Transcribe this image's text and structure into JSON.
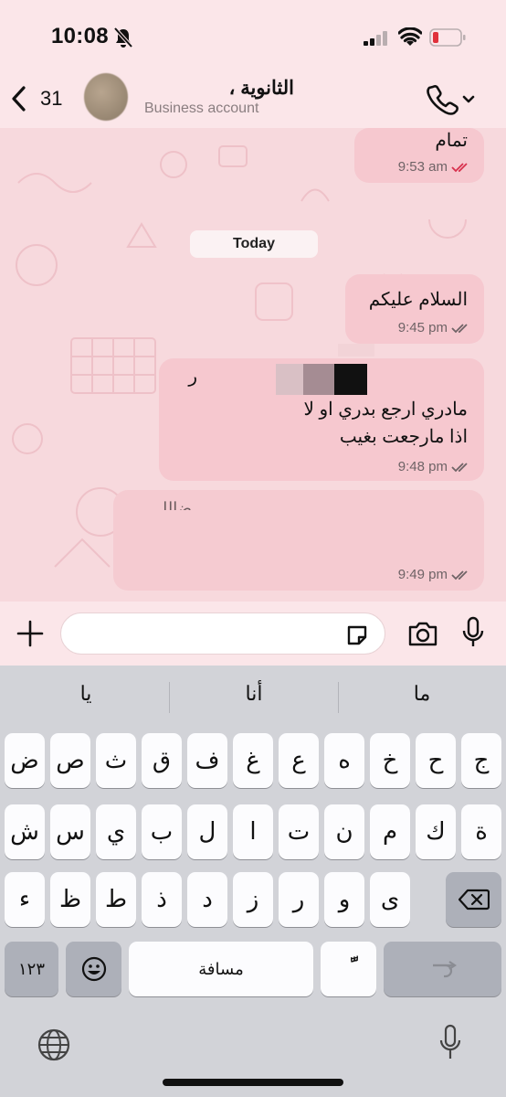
{
  "status": {
    "time": "10:08",
    "icons": [
      "bell-off-icon",
      "signal-icon",
      "wifi-icon",
      "battery-low-icon"
    ],
    "battery_color": "#e0313b"
  },
  "header": {
    "back_count": "31",
    "contact_name": "الثانوية ،",
    "contact_subtitle": "Business account",
    "icons": [
      "chevron-left-icon",
      "phone-icon",
      "chevron-down-icon"
    ]
  },
  "chat": {
    "date_separator": "Today",
    "messages": [
      {
        "text": "تمام",
        "time": "9:53 am",
        "status": "read",
        "tick_color": "#d8314e"
      },
      {
        "text": "السلام عليكم",
        "time": "9:45 pm",
        "status": "delivered",
        "tick_color": "#6f6366"
      },
      {
        "text_top": "ر",
        "line1": "مادري ارجع بدري او لا",
        "line2": "اذا مارجعت بغيب",
        "time": "9:48 pm",
        "status": "delivered",
        "tick_color": "#6f6366"
      },
      {
        "text": "ضالل",
        "time": "9:49 pm",
        "status": "delivered",
        "tick_color": "#6f6366"
      }
    ],
    "bubble_color": "#f6c8cf",
    "wallpaper_color": "#f7d9dd"
  },
  "composer": {
    "placeholder": "",
    "icons": [
      "plus-icon",
      "sticker-icon",
      "camera-icon",
      "microphone-icon"
    ]
  },
  "keyboard": {
    "suggestions": [
      "ما",
      "أنا",
      "يا"
    ],
    "row1": [
      "ض",
      "ص",
      "ث",
      "ق",
      "ف",
      "غ",
      "ع",
      "ه",
      "خ",
      "ح",
      "ج"
    ],
    "row2": [
      "ش",
      "س",
      "ي",
      "ب",
      "ل",
      "ا",
      "ت",
      "ن",
      "م",
      "ك",
      "ة"
    ],
    "row3": [
      "ء",
      "ظ",
      "ط",
      "ذ",
      "د",
      "ز",
      "ر",
      "و",
      "ى"
    ],
    "numbers_key": "١٢٣",
    "space_key": "مسافة",
    "tanween_key": "ًّ",
    "icons": [
      "backspace-icon",
      "emoji-icon",
      "return-icon",
      "globe-icon",
      "microphone-icon"
    ]
  }
}
